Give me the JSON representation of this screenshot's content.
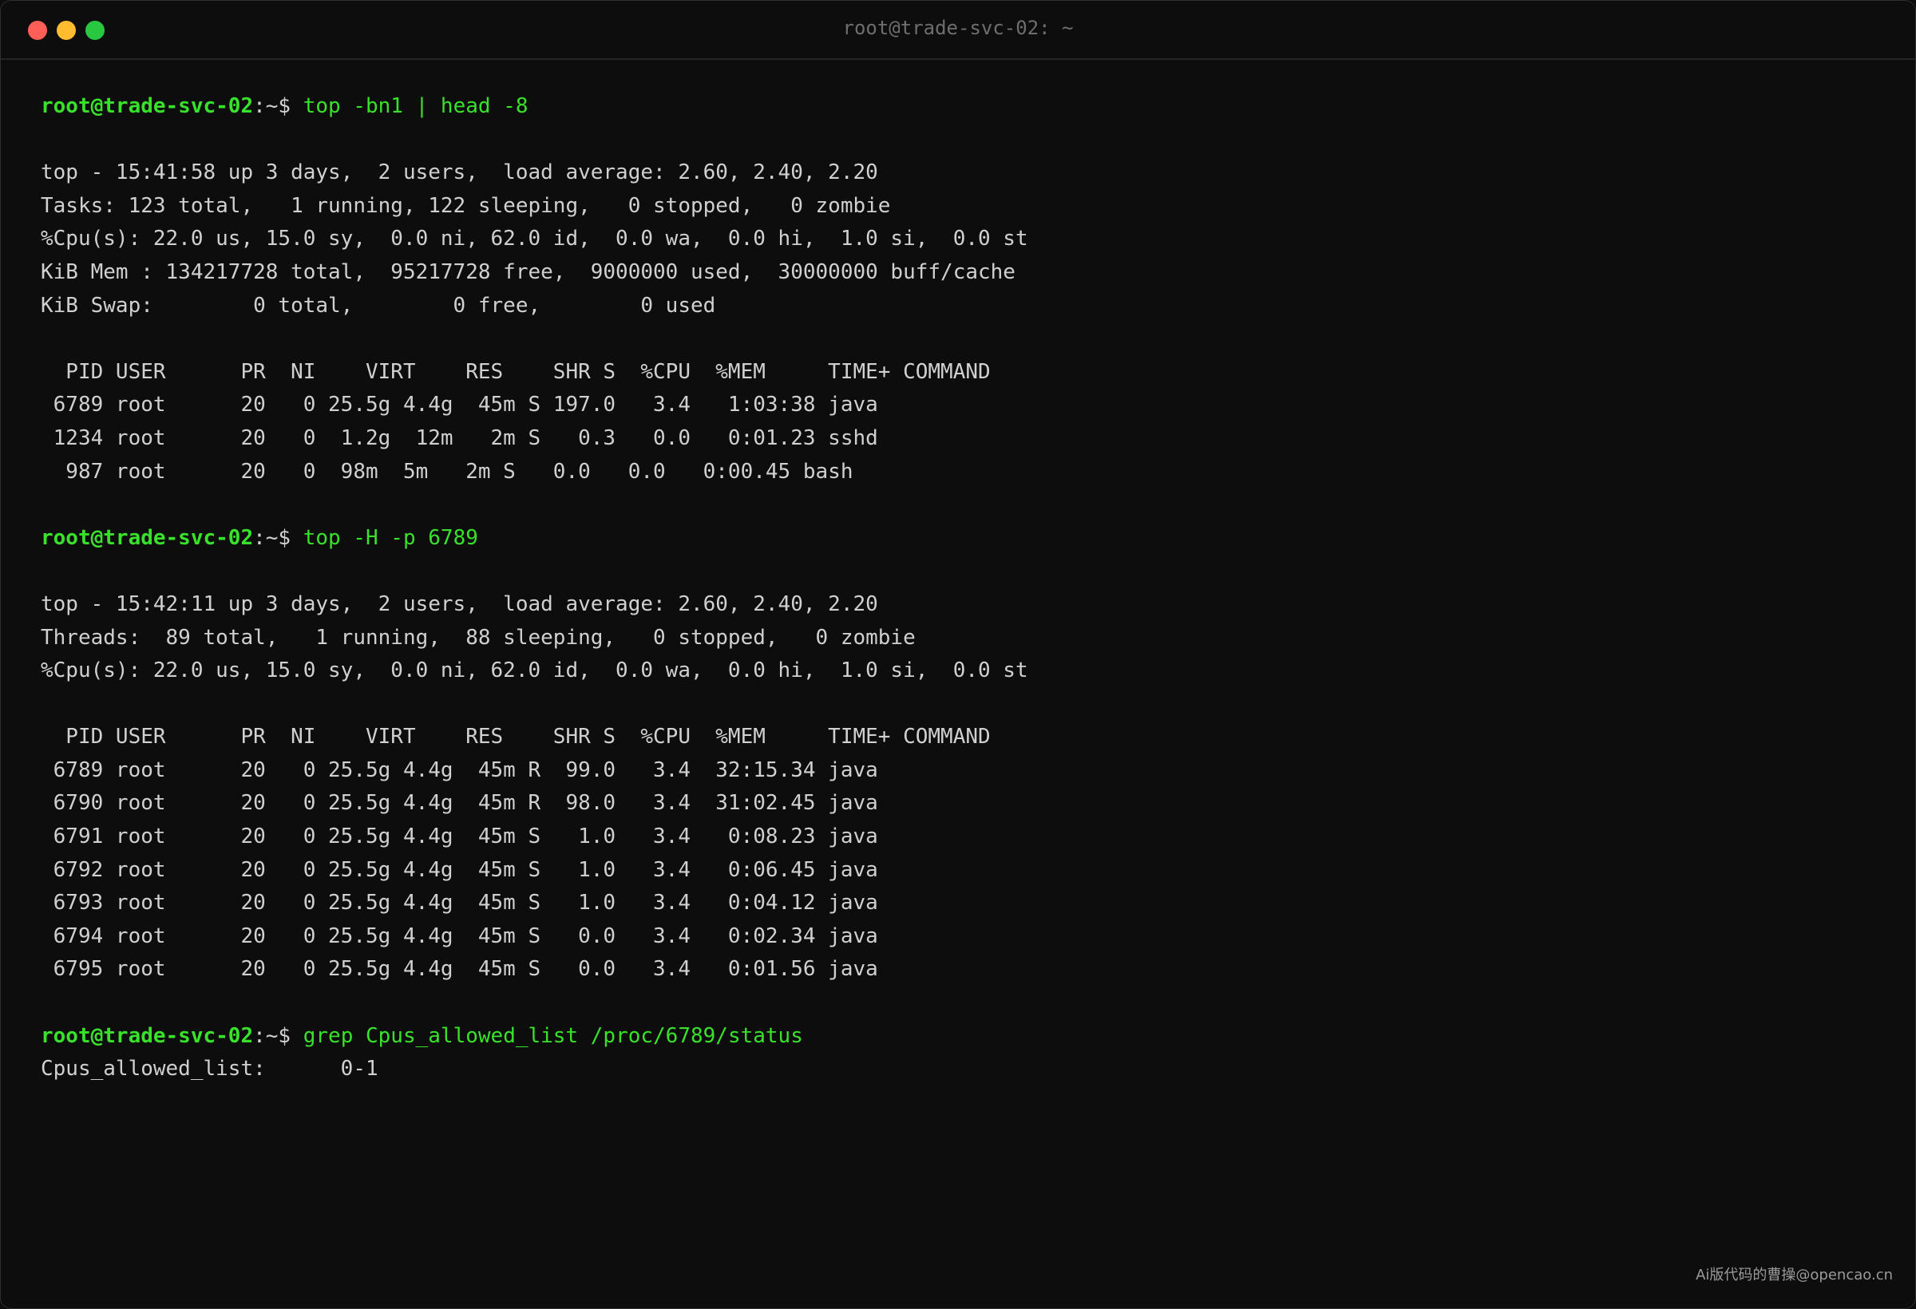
{
  "window": {
    "title": "root@trade-svc-02: ~"
  },
  "blocks": [
    {
      "prompt_user": "root@trade-svc-02",
      "prompt_sep": ":~$ ",
      "command": "top -bn1 | head -8",
      "output": [
        "",
        "top - 15:41:58 up 3 days,  2 users,  load average: 2.60, 2.40, 2.20",
        "Tasks: 123 total,   1 running, 122 sleeping,   0 stopped,   0 zombie",
        "%Cpu(s): 22.0 us, 15.0 sy,  0.0 ni, 62.0 id,  0.0 wa,  0.0 hi,  1.0 si,  0.0 st",
        "KiB Mem : 134217728 total,  95217728 free,  9000000 used,  30000000 buff/cache",
        "KiB Swap:        0 total,        0 free,        0 used",
        "",
        "  PID USER      PR  NI    VIRT    RES    SHR S  %CPU  %MEM     TIME+ COMMAND",
        " 6789 root      20   0 25.5g 4.4g  45m S 197.0   3.4   1:03:38 java",
        " 1234 root      20   0  1.2g  12m   2m S   0.3   0.0   0:01.23 sshd",
        "  987 root      20   0  98m  5m   2m S   0.0   0.0   0:00.45 bash",
        ""
      ]
    },
    {
      "prompt_user": "root@trade-svc-02",
      "prompt_sep": ":~$ ",
      "command": "top -H -p 6789",
      "output": [
        "",
        "top - 15:42:11 up 3 days,  2 users,  load average: 2.60, 2.40, 2.20",
        "Threads:  89 total,   1 running,  88 sleeping,   0 stopped,   0 zombie",
        "%Cpu(s): 22.0 us, 15.0 sy,  0.0 ni, 62.0 id,  0.0 wa,  0.0 hi,  1.0 si,  0.0 st",
        "",
        "  PID USER      PR  NI    VIRT    RES    SHR S  %CPU  %MEM     TIME+ COMMAND",
        " 6789 root      20   0 25.5g 4.4g  45m R  99.0   3.4  32:15.34 java",
        " 6790 root      20   0 25.5g 4.4g  45m R  98.0   3.4  31:02.45 java",
        " 6791 root      20   0 25.5g 4.4g  45m S   1.0   3.4   0:08.23 java",
        " 6792 root      20   0 25.5g 4.4g  45m S   1.0   3.4   0:06.45 java",
        " 6793 root      20   0 25.5g 4.4g  45m S   1.0   3.4   0:04.12 java",
        " 6794 root      20   0 25.5g 4.4g  45m S   0.0   3.4   0:02.34 java",
        " 6795 root      20   0 25.5g 4.4g  45m S   0.0   3.4   0:01.56 java",
        ""
      ]
    },
    {
      "prompt_user": "root@trade-svc-02",
      "prompt_sep": ":~$ ",
      "command": "grep Cpus_allowed_list /proc/6789/status",
      "output": [
        "Cpus_allowed_list:      0-1"
      ]
    }
  ],
  "watermark": "Ai版代码的曹操@opencao.cn",
  "colors": {
    "background": "#0d0d0d",
    "prompt": "#39e22a",
    "text": "#d0d0d0",
    "close": "#ff5f57",
    "minimize": "#febc2e",
    "maximize": "#28c840"
  }
}
